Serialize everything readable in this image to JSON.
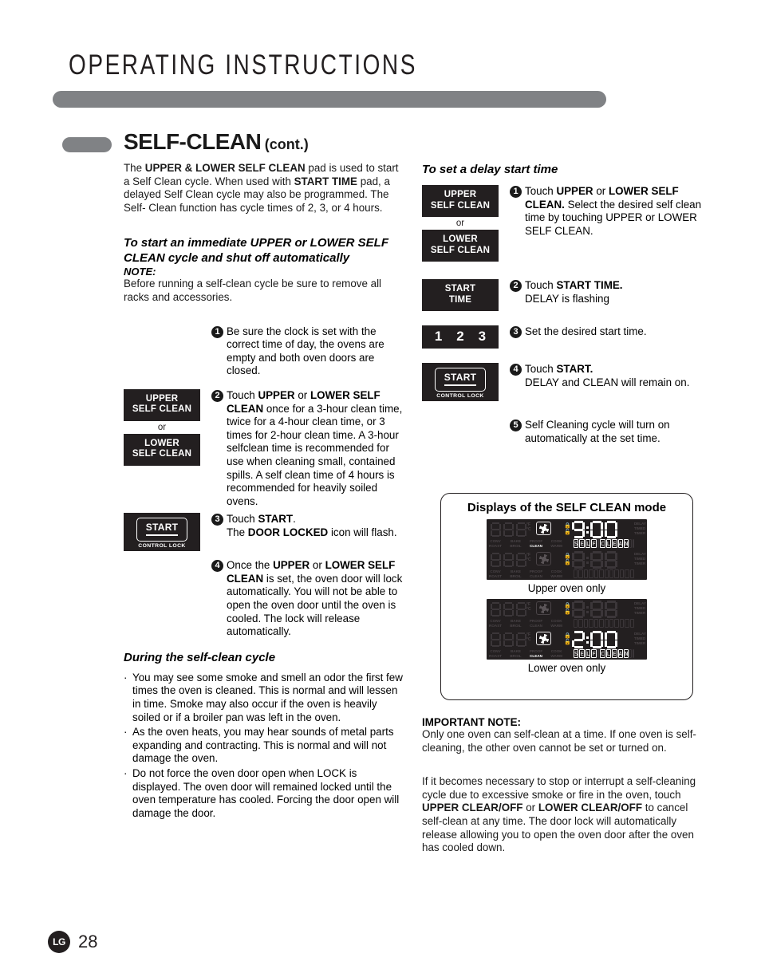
{
  "header": {
    "title": "OPERATING INSTRUCTIONS",
    "section_title_main": "SELF-CLEAN",
    "section_title_suffix": "(cont.)"
  },
  "left": {
    "intro": "The UPPER & LOWER SELF CLEAN pad is used to start a Self Clean cycle. When used with START TIME pad, a delayed Self Clean cycle may also be programmed. The Self- Clean function has cycle times of 2, 3, or 4 hours.",
    "subhead": "To start an immediate UPPER or LOWER SELF CLEAN cycle and shut off automatically",
    "note_label": "NOTE:",
    "note_text": "Before running a self-clean cycle be sure to remove all racks and accessories.",
    "steps": [
      {
        "num": "1",
        "text": "Be sure the clock is set with the correct time of day, the ovens are empty and both oven doors are closed.",
        "pad": null
      },
      {
        "num": "2",
        "text": "Touch UPPER or LOWER SELF CLEAN once for a 3-hour clean time, twice for a 4-hour clean time, or 3 times for 2-hour clean time. A 3-hour selfclean time is recommended for use when cleaning small, contained spills. A self clean time of 4 hours is recommended for heavily soiled ovens.",
        "pad": "upper-lower-self-clean"
      },
      {
        "num": "3",
        "text": "Touch START. The DOOR LOCKED icon will flash.",
        "pad": "start"
      },
      {
        "num": "4",
        "text": "Once the UPPER or LOWER SELF CLEAN is set, the oven door will lock automatically. You will not be able to open the oven door until the oven is cooled. The lock will release automatically.",
        "pad": null
      }
    ],
    "during_subhead": "During the self-clean cycle",
    "bullets": [
      "You may see some smoke and smell an odor the first few times the oven is cleaned. This is normal and will lessen in time. Smoke may also occur if the oven is heavily soiled or if a broiler pan was left in the oven.",
      "As the oven heats, you may hear sounds of metal parts expanding and contracting. This is normal and will not damage the oven.",
      "Do not force the oven door open when LOCK is displayed. The oven door will remained locked until the oven temperature has cooled. Forcing the door open will damage the door."
    ]
  },
  "right": {
    "subhead": "To set a delay start time",
    "steps": [
      {
        "num": "1",
        "text": "Touch UPPER or LOWER SELF CLEAN. Select the desired self clean time by touching UPPER or LOWER SELF CLEAN.",
        "pad": "upper-lower-self-clean"
      },
      {
        "num": "2",
        "text": "Touch START TIME. DELAY is flashing",
        "pad": "start-time"
      },
      {
        "num": "3",
        "text": "Set the desired start time.",
        "pad": "digits"
      },
      {
        "num": "4",
        "text": "Touch START. DELAY and CLEAN will remain on.",
        "pad": "start"
      },
      {
        "num": "5",
        "text": "Self Cleaning cycle will turn on automatically at the set time.",
        "pad": null
      }
    ],
    "important_label": "IMPORTANT NOTE:",
    "important_p1": "Only one oven can self-clean at a time. If one oven is self-cleaning, the other oven cannot be set or turned on.",
    "important_p2": "If it becomes necessary to stop or interrupt a self-cleaning cycle due to excessive smoke or fire in the oven, touch UPPER CLEAR/OFF or LOWER CLEAR/OFF to cancel self-clean at any time. The door lock will automatically release allowing you to open the oven door after the oven has cooled down."
  },
  "pads": {
    "upper_line1": "UPPER",
    "upper_line2": "SELF CLEAN",
    "or": "or",
    "lower_line1": "LOWER",
    "lower_line2": "SELF CLEAN",
    "start_label": "START",
    "start_sublabel": "CONTROL LOCK",
    "start_time_line1": "START",
    "start_time_line2": "TIME",
    "digits": [
      "1",
      "2",
      "3"
    ]
  },
  "displays": {
    "box_title": "Displays of the SELF CLEAN mode",
    "upper_caption": "Upper oven only",
    "lower_caption": "Lower oven only",
    "upper_time": "3:00",
    "lower_time": "2:00",
    "mode_text": "SELF CLEAN",
    "temp_units": [
      "°F",
      "°C"
    ],
    "mode_labels": [
      "CONV ROAST",
      "BAKE BROIL",
      "PROOF CLEAN",
      "COOK WARM"
    ],
    "right_labels": [
      "DELAY",
      "TIMED",
      "TIMER"
    ],
    "lit_mode_label": "CLEAN"
  },
  "footer": {
    "page_number": "28",
    "logo": "LG"
  },
  "colors": {
    "gray_bar": "#808285",
    "ink": "#231f20",
    "led_bg": "#231f20",
    "led_dim": "#3b3639",
    "led_lit": "#ffffff"
  }
}
